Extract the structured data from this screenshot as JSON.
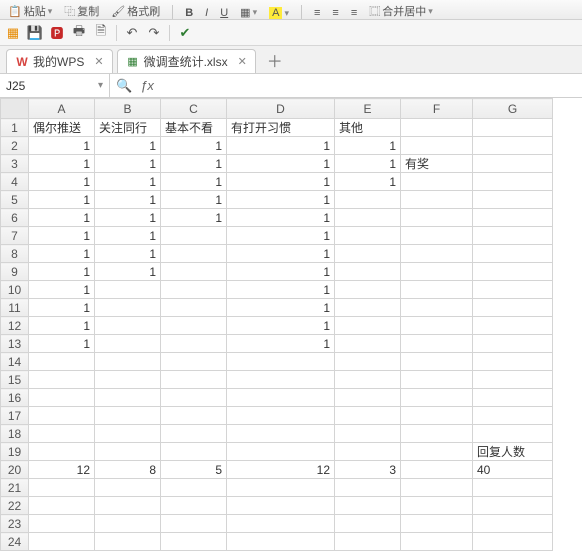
{
  "toolbar1": {
    "paste": "粘贴",
    "copy": "复制",
    "format_painter": "格式刷",
    "merge_center": "合并居中"
  },
  "tabs": [
    {
      "label": "我的WPS",
      "closable": true
    },
    {
      "label": "微调查统计.xlsx",
      "closable": true
    }
  ],
  "namebox": {
    "ref": "J25"
  },
  "columns": [
    "A",
    "B",
    "C",
    "D",
    "E",
    "F",
    "G"
  ],
  "headers": {
    "A": "偶尔推送",
    "B": "关注同行",
    "C": "基本不看",
    "D": "有打开习惯",
    "E": "其他",
    "F": "",
    "G": ""
  },
  "rows": [
    {
      "r": 1,
      "A": "偶尔推送",
      "B": "关注同行",
      "C": "基本不看",
      "D": "有打开习惯",
      "E": "其他",
      "F": "",
      "G": ""
    },
    {
      "r": 2,
      "A": "1",
      "B": "1",
      "C": "1",
      "D": "1",
      "E": "1",
      "F": "",
      "G": ""
    },
    {
      "r": 3,
      "A": "1",
      "B": "1",
      "C": "1",
      "D": "1",
      "E": "1",
      "F": "有奖",
      "G": ""
    },
    {
      "r": 4,
      "A": "1",
      "B": "1",
      "C": "1",
      "D": "1",
      "E": "1",
      "F": "",
      "G": ""
    },
    {
      "r": 5,
      "A": "1",
      "B": "1",
      "C": "1",
      "D": "1",
      "E": "",
      "F": "",
      "G": ""
    },
    {
      "r": 6,
      "A": "1",
      "B": "1",
      "C": "1",
      "D": "1",
      "E": "",
      "F": "",
      "G": ""
    },
    {
      "r": 7,
      "A": "1",
      "B": "1",
      "C": "",
      "D": "1",
      "E": "",
      "F": "",
      "G": ""
    },
    {
      "r": 8,
      "A": "1",
      "B": "1",
      "C": "",
      "D": "1",
      "E": "",
      "F": "",
      "G": ""
    },
    {
      "r": 9,
      "A": "1",
      "B": "1",
      "C": "",
      "D": "1",
      "E": "",
      "F": "",
      "G": ""
    },
    {
      "r": 10,
      "A": "1",
      "B": "",
      "C": "",
      "D": "1",
      "E": "",
      "F": "",
      "G": ""
    },
    {
      "r": 11,
      "A": "1",
      "B": "",
      "C": "",
      "D": "1",
      "E": "",
      "F": "",
      "G": ""
    },
    {
      "r": 12,
      "A": "1",
      "B": "",
      "C": "",
      "D": "1",
      "E": "",
      "F": "",
      "G": ""
    },
    {
      "r": 13,
      "A": "1",
      "B": "",
      "C": "",
      "D": "1",
      "E": "",
      "F": "",
      "G": ""
    },
    {
      "r": 14,
      "A": "",
      "B": "",
      "C": "",
      "D": "",
      "E": "",
      "F": "",
      "G": ""
    },
    {
      "r": 15,
      "A": "",
      "B": "",
      "C": "",
      "D": "",
      "E": "",
      "F": "",
      "G": ""
    },
    {
      "r": 16,
      "A": "",
      "B": "",
      "C": "",
      "D": "",
      "E": "",
      "F": "",
      "G": ""
    },
    {
      "r": 17,
      "A": "",
      "B": "",
      "C": "",
      "D": "",
      "E": "",
      "F": "",
      "G": ""
    },
    {
      "r": 18,
      "A": "",
      "B": "",
      "C": "",
      "D": "",
      "E": "",
      "F": "",
      "G": ""
    },
    {
      "r": 19,
      "A": "",
      "B": "",
      "C": "",
      "D": "",
      "E": "",
      "F": "",
      "G": "回复人数"
    },
    {
      "r": 20,
      "A": "12",
      "B": "8",
      "C": "5",
      "D": "12",
      "E": "3",
      "F": "",
      "G": "40"
    },
    {
      "r": 21,
      "A": "",
      "B": "",
      "C": "",
      "D": "",
      "E": "",
      "F": "",
      "G": ""
    },
    {
      "r": 22,
      "A": "",
      "B": "",
      "C": "",
      "D": "",
      "E": "",
      "F": "",
      "G": ""
    },
    {
      "r": 23,
      "A": "",
      "B": "",
      "C": "",
      "D": "",
      "E": "",
      "F": "",
      "G": ""
    },
    {
      "r": 24,
      "A": "",
      "B": "",
      "C": "",
      "D": "",
      "E": "",
      "F": "",
      "G": ""
    }
  ],
  "text_columns": [
    "F",
    "G"
  ],
  "row1_text": true
}
